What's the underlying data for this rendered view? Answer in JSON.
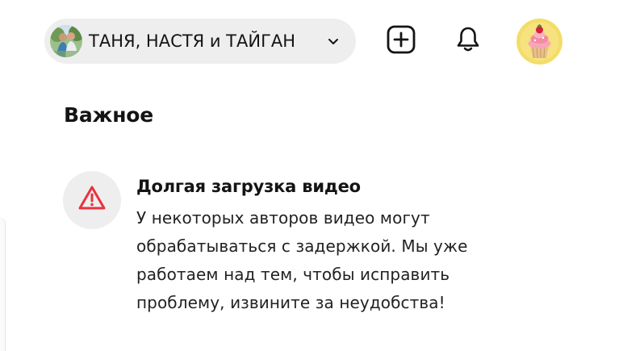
{
  "header": {
    "channel_name": "ТАНЯ, НАСТЯ и ТАЙГАН",
    "icons": {
      "channel_avatar": "channel-avatar-photo",
      "switch": "chevron-down-icon",
      "create": "add-square-icon",
      "notifications": "bell-icon",
      "profile": "cupcake-avatar"
    }
  },
  "section": {
    "title": "Важное"
  },
  "notice": {
    "icon": "warning-triangle-icon",
    "title": "Долгая загрузка видео",
    "body": "У некоторых авторов видео могут обрабатываться с задержкой. Мы уже работаем над тем, чтобы исправить проблему, извините за неудобства!",
    "accent_color": "#e8333f"
  }
}
